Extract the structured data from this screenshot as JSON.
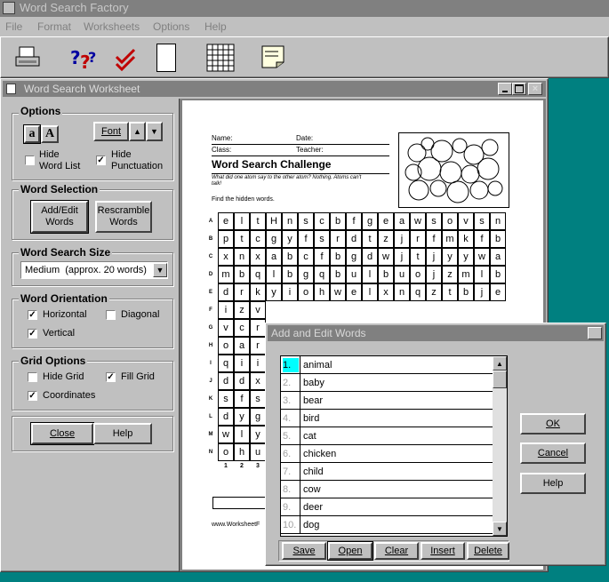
{
  "app": {
    "title": "Word Search Factory"
  },
  "menu": [
    "File",
    "Format",
    "Worksheets",
    "Options",
    "Help"
  ],
  "toolbar": {
    "icons": [
      "printer-icon",
      "help-icon",
      "spell-check-icon",
      "new-page-icon",
      "grid-icon",
      "note-icon"
    ]
  },
  "worksheet_window": {
    "title": "Word Search Worksheet"
  },
  "options_panel": {
    "options": {
      "title": "Options",
      "font_label": "Font",
      "hide_word_list": "Hide Word List",
      "hide_punctuation": "Hide Punctuation",
      "hide_word_list_checked": false,
      "hide_punctuation_checked": true
    },
    "word_selection": {
      "title": "Word Selection",
      "add_edit": "Add/Edit Words",
      "rescramble": "Rescramble Words"
    },
    "size": {
      "title": "Word Search Size",
      "value": "Medium  (approx. 20 words)"
    },
    "orientation": {
      "title": "Word Orientation",
      "horizontal": "Horizontal",
      "diagonal": "Diagonal",
      "vertical": "Vertical",
      "horizontal_checked": true,
      "diagonal_checked": false,
      "vertical_checked": true
    },
    "grid_options": {
      "title": "Grid Options",
      "hide_grid": "Hide Grid",
      "fill_grid": "Fill Grid",
      "coordinates": "Coordinates",
      "hide_grid_checked": false,
      "fill_grid_checked": true,
      "coordinates_checked": true
    },
    "close": "Close",
    "help": "Help"
  },
  "sheet": {
    "name_label": "Name:",
    "date_label": "Date:",
    "class_label": "Class:",
    "teacher_label": "Teacher:",
    "title": "Word Search Challenge",
    "subtitle": "What did one atom say to the other atom? Nothing. Atoms can't talk!",
    "instructions": "Find the hidden words.",
    "footer": "www.WorksheetF",
    "row_labels": [
      "A",
      "B",
      "C",
      "D",
      "E",
      "F",
      "G",
      "H",
      "I",
      "J",
      "K",
      "L",
      "M",
      "N"
    ],
    "col_labels": [
      "1",
      "2",
      "3"
    ],
    "rows": [
      "eltHnscbfgeawsovsn",
      "ptcgyfsrdtzjrfmkfb",
      "xnxabcfbgdwjtjyywa",
      "mbqlbgqbulbuojzmlb",
      "drkyiohwelxnqztbje",
      "izv",
      "vcr",
      "oar",
      "qii",
      "ddx",
      "sfs",
      "dyg",
      "wly",
      "ohu"
    ]
  },
  "dialog": {
    "title": "Add and Edit Words",
    "words": [
      {
        "n": "1.",
        "w": "animal"
      },
      {
        "n": "2.",
        "w": "baby"
      },
      {
        "n": "3.",
        "w": "bear"
      },
      {
        "n": "4.",
        "w": "bird"
      },
      {
        "n": "5.",
        "w": "cat"
      },
      {
        "n": "6.",
        "w": "chicken"
      },
      {
        "n": "7.",
        "w": "child"
      },
      {
        "n": "8.",
        "w": "cow"
      },
      {
        "n": "9.",
        "w": "deer"
      },
      {
        "n": "10.",
        "w": "dog"
      }
    ],
    "ok": "OK",
    "cancel": "Cancel",
    "help": "Help",
    "save": "Save",
    "open": "Open",
    "clear": "Clear",
    "insert": "Insert",
    "delete": "Delete",
    "close_glyph": "×"
  },
  "colors": {
    "desktop": "#008080",
    "selection": "#00ffff",
    "inactive_title": "#808080"
  }
}
